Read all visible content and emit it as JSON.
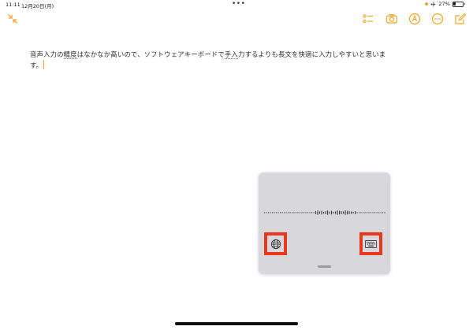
{
  "status_bar": {
    "time": "11:11",
    "date": "12月20日(月)",
    "multitask_dots": "•••",
    "battery_percent_label": "27%",
    "battery_level": 0.27
  },
  "toolbar": {
    "collapse_icon": "collapse-arrows-icon",
    "checklist_icon": "checklist-icon",
    "camera_icon": "camera-icon",
    "markup_icon": "markup-pen-icon",
    "more_icon": "more-ellipsis-icon",
    "compose_icon": "compose-icon",
    "accent_color": "#f1a325"
  },
  "note": {
    "line1_part1": "音声入力の精度はなかなか高いので、ソフトウェアキーボードで手入力するよりも長文を快適に入力しやすいと思いま",
    "line2": "す。"
  },
  "dictation_panel": {
    "globe_icon": "globe-icon",
    "keyboard_icon": "keyboard-icon",
    "highlight_color": "#e8391e"
  }
}
